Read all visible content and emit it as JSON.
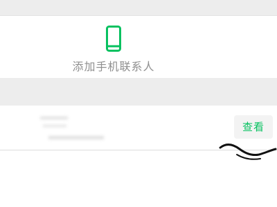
{
  "add_contact": {
    "label": "添加手机联系人",
    "icon": "phone-icon",
    "icon_color": "#07c160"
  },
  "contact": {
    "view_button_label": "查看"
  },
  "colors": {
    "accent": "#07c160",
    "background_gray": "#ededed",
    "label_gray": "#8f8f8f"
  }
}
